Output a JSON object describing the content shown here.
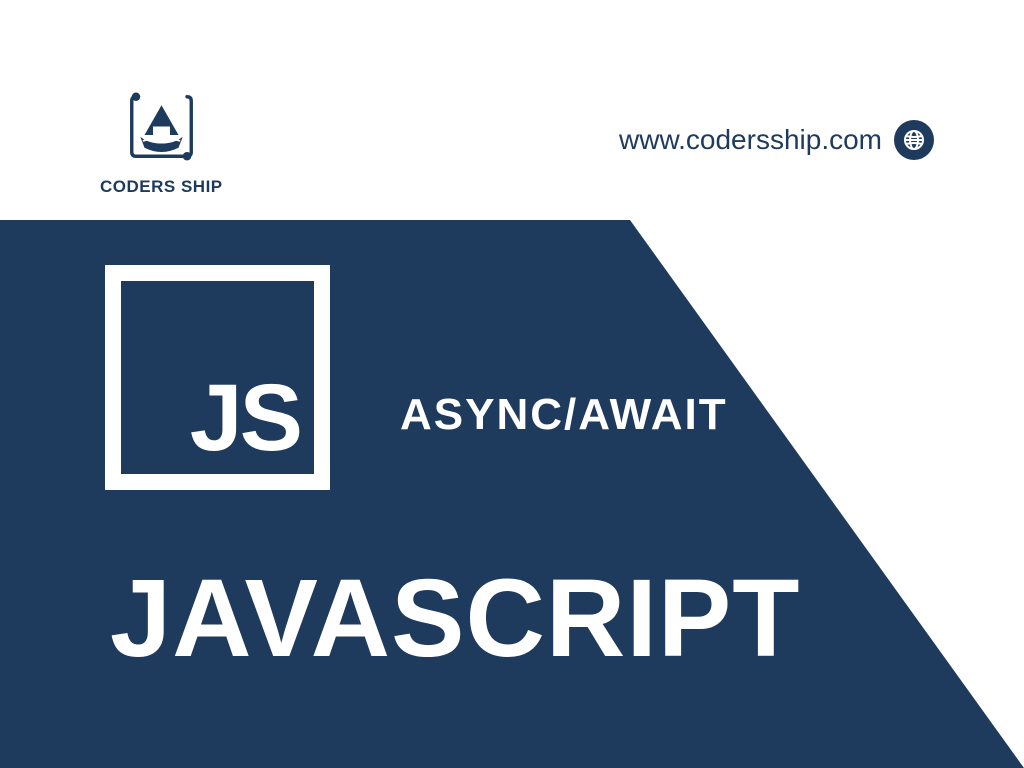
{
  "brand": {
    "name": "CODERS SHIP",
    "url": "www.codersship.com",
    "primary_color": "#1e3a5c"
  },
  "hero": {
    "badge_text": "JS",
    "topic": "ASYNC/AWAIT",
    "language": "JAVASCRIPT"
  }
}
